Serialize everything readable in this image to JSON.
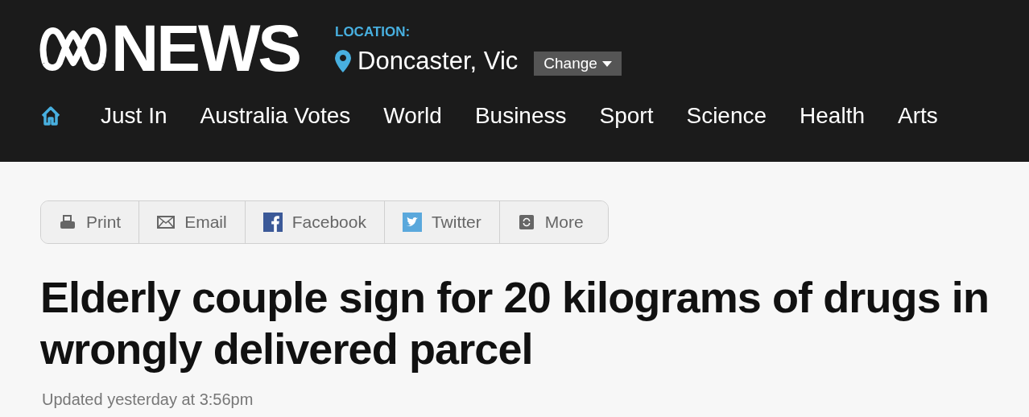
{
  "header": {
    "brand": "NEWS",
    "location_label": "LOCATION:",
    "location": "Doncaster, Vic",
    "change_button": "Change"
  },
  "nav": {
    "items": [
      "Just In",
      "Australia Votes",
      "World",
      "Business",
      "Sport",
      "Science",
      "Health",
      "Arts"
    ]
  },
  "share": [
    {
      "kind": "print",
      "label": "Print"
    },
    {
      "kind": "email",
      "label": "Email"
    },
    {
      "kind": "facebook",
      "label": "Facebook"
    },
    {
      "kind": "twitter",
      "label": "Twitter"
    },
    {
      "kind": "more",
      "label": "More"
    }
  ],
  "article": {
    "headline": "Elderly couple sign for 20 kilograms of drugs in wrongly delivered parcel",
    "updated": "Updated yesterday at 3:56pm"
  }
}
